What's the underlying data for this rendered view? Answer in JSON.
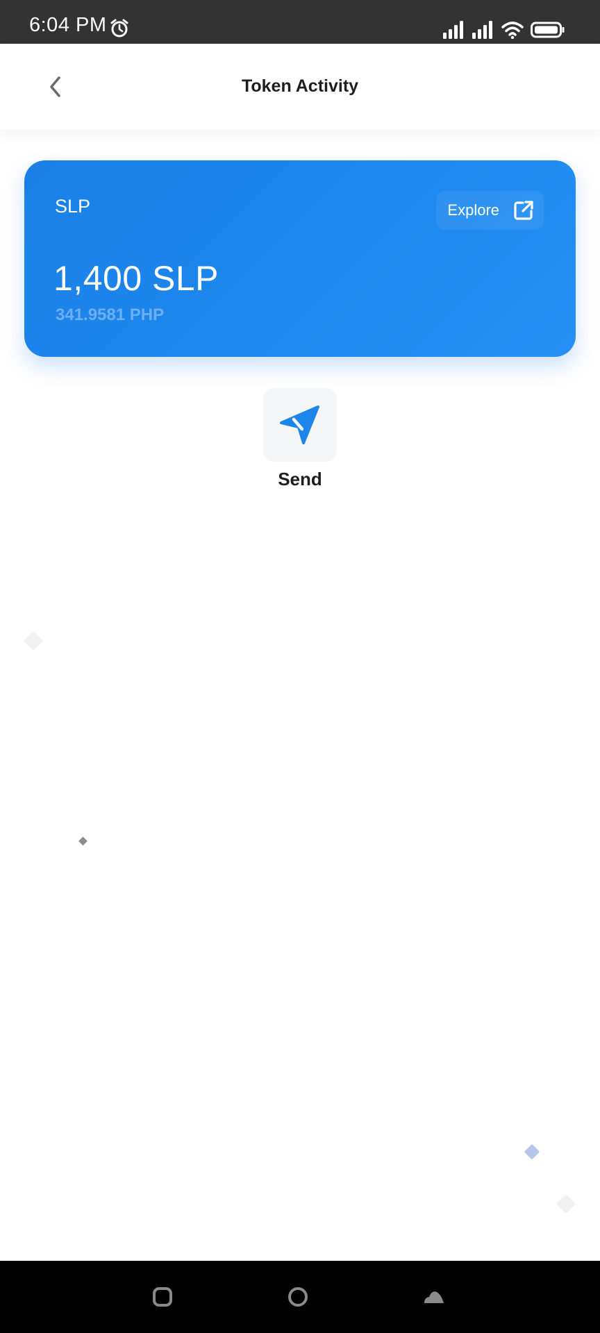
{
  "status_bar": {
    "time": "6:04 PM",
    "icons": [
      "alarm-icon",
      "signal-icon",
      "signal-icon",
      "wifi-icon",
      "battery-icon"
    ]
  },
  "app_bar": {
    "title": "Token Activity",
    "back_icon": "chevron-left-icon"
  },
  "token_card": {
    "symbol": "SLP",
    "explore_label": "Explore",
    "explore_icon": "external-link-icon",
    "balance": "1,400 SLP",
    "fiat_value": "341.9581 PHP",
    "color": "#1e88ee"
  },
  "actions": {
    "send_label": "Send",
    "send_icon": "paper-plane-icon",
    "icon_color": "#1e86ea"
  },
  "nav_bar": {
    "icons": [
      "recents-icon",
      "home-icon",
      "back-icon"
    ]
  }
}
